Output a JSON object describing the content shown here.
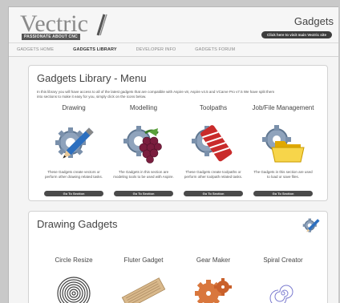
{
  "header": {
    "logo_text": "Vectric",
    "logo_tagline": "PASSIONATE ABOUT CNC",
    "page_heading": "Gadgets",
    "visit_button": "Click here to visit main Vectric site"
  },
  "nav": {
    "items": [
      {
        "label": "GADGETS HOME",
        "active": false
      },
      {
        "label": "GADGETS LIBRARY",
        "active": true
      },
      {
        "label": "DEVELOPER INFO",
        "active": false
      },
      {
        "label": "GADGETS FORUM",
        "active": false
      }
    ]
  },
  "library": {
    "title": "Gadgets Library - Menu",
    "intro": "In this library you will have access to all of the latest gadgets that are compatible with Aspire v8, Aspire v4.5 and VCarve Pro v7.5 We have split them into sections to make it easy for you, simply click on the icons below.",
    "sections": [
      {
        "title": "Drawing",
        "icon": "drawing-gear-pencil-icon",
        "desc": "These Gadgets create vectors or perform other drawing related tasks.",
        "button": "Go To Section"
      },
      {
        "title": "Modelling",
        "icon": "modelling-gear-grapes-icon",
        "desc": "The Gadgets in this section are modeling tools to be used with Aspire.",
        "button": "Go To Section"
      },
      {
        "title": "Toolpaths",
        "icon": "toolpaths-gear-cutter-icon",
        "desc": "These Gadgets create toolpaths or perform other toolpath related tasks.",
        "button": "Go To Section"
      },
      {
        "title": "Job/File Management",
        "icon": "file-gear-folder-icon",
        "desc": "The Gadgets in this section are used to load or save files.",
        "button": "Go To Section"
      }
    ]
  },
  "drawing": {
    "title": "Drawing Gadgets",
    "icon": "drawing-gear-pencil-icon",
    "gadgets": [
      {
        "name": "Circle Resize",
        "icon": "concentric-circles-icon"
      },
      {
        "name": "Fluter Gadget",
        "icon": "fluted-board-icon"
      },
      {
        "name": "Gear Maker",
        "icon": "gears-icon"
      },
      {
        "name": "Spiral Creator",
        "icon": "spiral-icon"
      }
    ]
  }
}
